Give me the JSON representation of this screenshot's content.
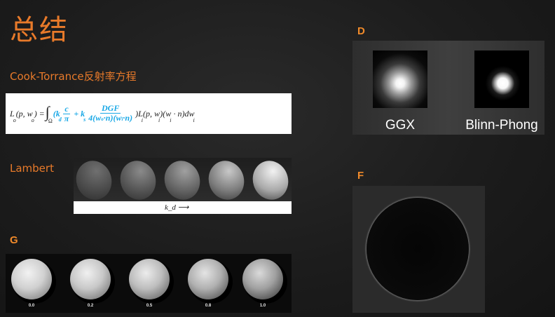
{
  "title": "总结",
  "cook_torrance": {
    "label": "Cook-Torrance反射率方程",
    "equation": {
      "lhs": "L",
      "lhs_sub": "o",
      "lhs_args": "(p, w",
      "lhs_args_sub": "o",
      "eq": ") =",
      "integral_sub": "Ω",
      "kd_term": "(k",
      "kd_sub": "d",
      "c_num": "c",
      "c_den": "π",
      "plus_ks": "+ k",
      "ks_sub": "s",
      "dgf_num": "DGF",
      "dgf_den": "4(w·n)(w·n)",
      "rhs": ")L(p, w)(w · n)dw"
    }
  },
  "lambert": {
    "label": "Lambert",
    "caption": "k_d ⟶"
  },
  "g_section": {
    "label": "G",
    "values": [
      "0.0",
      "0.2",
      "0.5",
      "0.8",
      "1.0"
    ]
  },
  "d_section": {
    "label": "D",
    "left_caption": "GGX",
    "right_caption": "Blinn-Phong"
  },
  "f_section": {
    "label": "F"
  },
  "colors": {
    "accent_orange": "#e87a2a",
    "equation_highlight": "#19a8e6",
    "background": "#1c1c1c"
  }
}
